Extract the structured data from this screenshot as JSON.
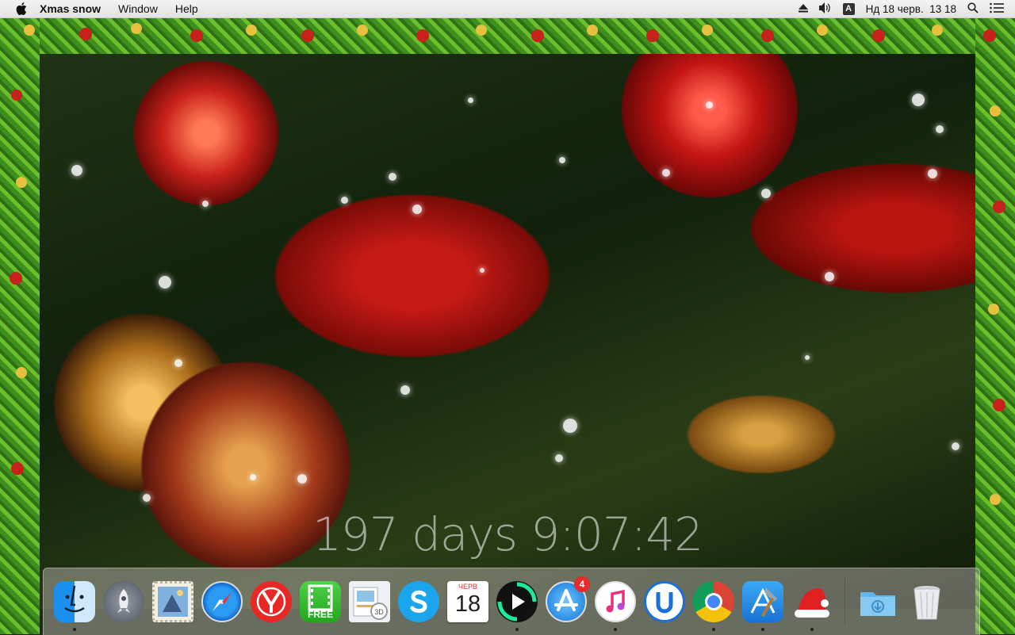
{
  "menubar": {
    "app_name": "Xmas snow",
    "menus": [
      "Window",
      "Help"
    ],
    "status": {
      "input_source": "A",
      "datetime": "Нд 18 черв.  13 18"
    },
    "icons": [
      "apple-icon",
      "eject-icon",
      "volume-icon",
      "input-source-icon",
      "spotlight-icon",
      "notification-center-icon"
    ]
  },
  "countdown": {
    "text": "197 days 9:07:42"
  },
  "dock": {
    "apps": [
      {
        "name": "finder",
        "running": true
      },
      {
        "name": "launchpad",
        "running": false
      },
      {
        "name": "mail-stamp",
        "running": false
      },
      {
        "name": "safari",
        "running": false
      },
      {
        "name": "yandex-browser",
        "running": false
      },
      {
        "name": "filmage",
        "label": "FREE",
        "running": false
      },
      {
        "name": "preview",
        "running": false
      },
      {
        "name": "skype",
        "running": false
      },
      {
        "name": "calendar",
        "month": "ЧЕРВ",
        "day": "18",
        "running": false
      },
      {
        "name": "video-player",
        "running": true
      },
      {
        "name": "app-store",
        "badge": "4",
        "running": false
      },
      {
        "name": "itunes",
        "running": true
      },
      {
        "name": "ulysses",
        "running": false
      },
      {
        "name": "chrome",
        "running": true
      },
      {
        "name": "xcode",
        "running": true
      },
      {
        "name": "xmas-snow",
        "running": true
      }
    ],
    "right": [
      {
        "name": "downloads-folder"
      },
      {
        "name": "trash"
      }
    ]
  },
  "colors": {
    "garland_green": "#4f9e23",
    "ornament_red": "#c21512",
    "ornament_gold": "#d7a040"
  }
}
